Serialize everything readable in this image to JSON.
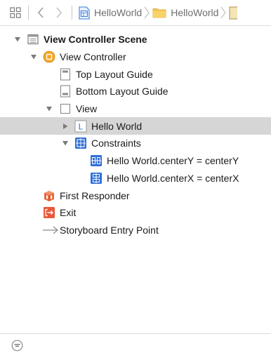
{
  "jumpbar": {
    "grid_icon": "related-items-grid-icon",
    "back_icon": "chevron-left-icon",
    "forward_icon": "chevron-right-icon",
    "crumbs": [
      {
        "label": "HelloWorld",
        "icon": "project-file-icon"
      },
      {
        "label": "HelloWorld",
        "icon": "yellow-folder-icon"
      }
    ]
  },
  "outline": {
    "rows": [
      {
        "label": "View Controller Scene",
        "bold": true,
        "icon": "scene-icon",
        "disclosure": "open",
        "indent": 0
      },
      {
        "label": "View Controller",
        "icon": "view-controller-icon",
        "disclosure": "open",
        "indent": 1
      },
      {
        "label": "Top Layout Guide",
        "icon": "top-layout-guide-icon",
        "disclosure": "none",
        "indent": 2
      },
      {
        "label": "Bottom Layout Guide",
        "icon": "bottom-layout-guide-icon",
        "disclosure": "none",
        "indent": 2
      },
      {
        "label": "View",
        "icon": "view-icon",
        "disclosure": "open",
        "indent": 2
      },
      {
        "label": "Hello World",
        "icon": "label-icon",
        "icon_text": "L",
        "disclosure": "closed",
        "indent": 3,
        "selected": true
      },
      {
        "label": "Constraints",
        "icon": "constraints-icon",
        "disclosure": "open",
        "indent": 3
      },
      {
        "label": "Hello World.centerY = centerY",
        "icon": "center-y-constraint-icon",
        "disclosure": "none",
        "indent": 4
      },
      {
        "label": "Hello World.centerX = centerX",
        "icon": "center-x-constraint-icon",
        "disclosure": "none",
        "indent": 4
      },
      {
        "label": "First Responder",
        "icon": "first-responder-icon",
        "disclosure": "none",
        "indent": 1
      },
      {
        "label": "Exit",
        "icon": "exit-icon",
        "disclosure": "none",
        "indent": 1
      },
      {
        "label": "Storyboard Entry Point",
        "icon": "entry-point-arrow-icon",
        "disclosure": "none",
        "indent": 1
      }
    ]
  },
  "filterbar": {
    "filter_icon": "filter-icon"
  },
  "colors": {
    "selection": "#d6d6d6",
    "view_controller_yellow": "#f5a623",
    "constraint_blue": "#2f6fd8",
    "exit_red": "#e85a3a",
    "first_responder_orange": "#e8643a"
  }
}
